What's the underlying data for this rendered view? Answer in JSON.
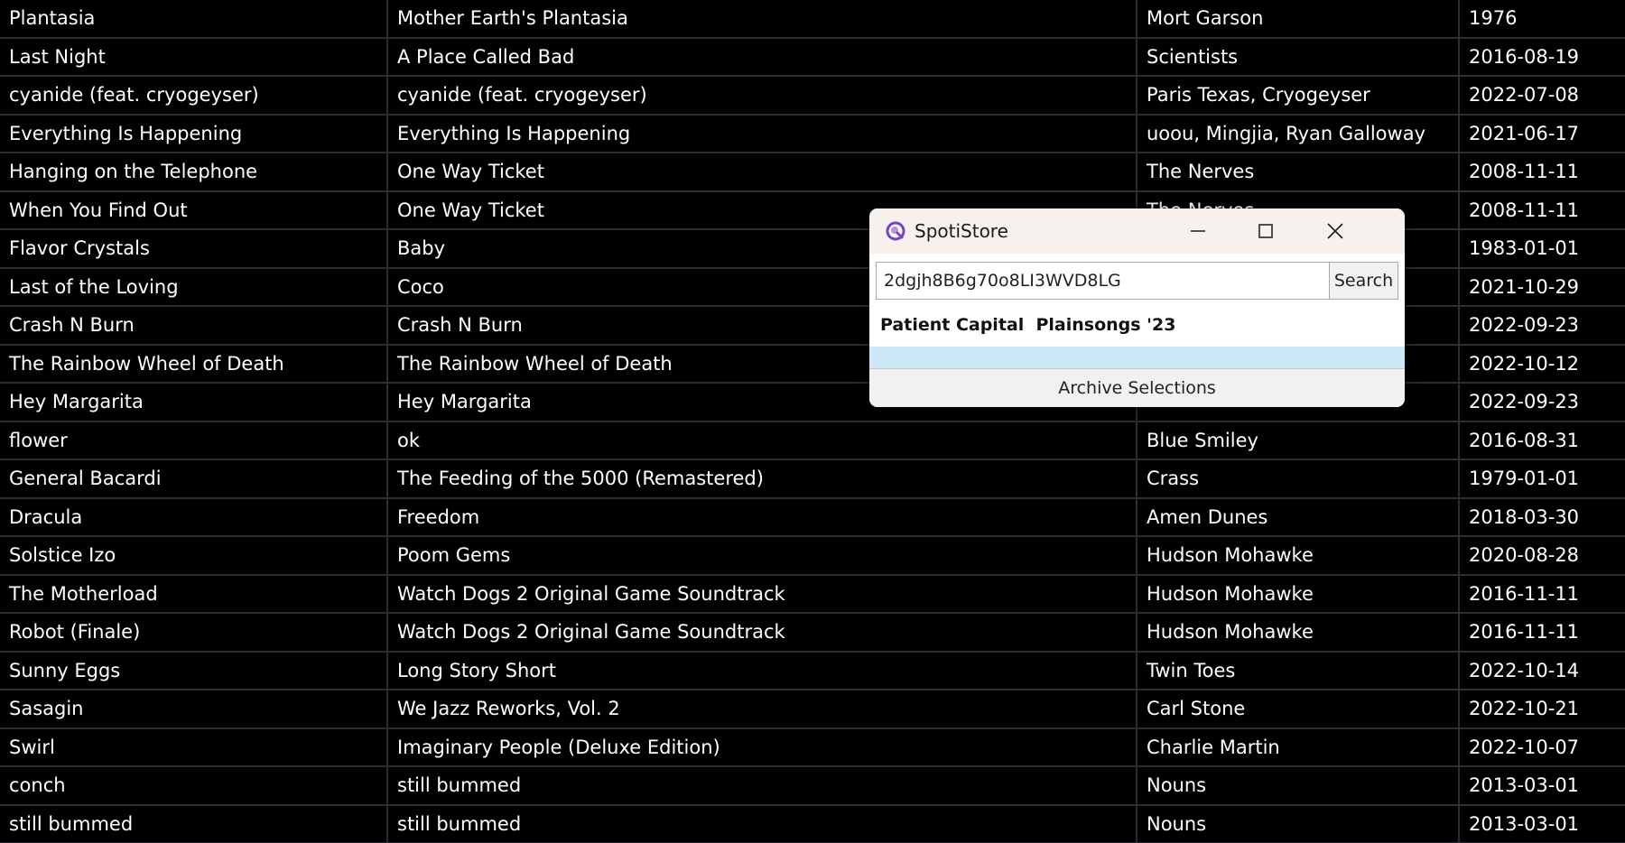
{
  "table": {
    "rows": [
      {
        "title": "Plantasia",
        "album": "Mother Earth's Plantasia",
        "artist": "Mort Garson",
        "date": "1976"
      },
      {
        "title": "Last Night",
        "album": "A Place Called Bad",
        "artist": "Scientists",
        "date": "2016-08-19"
      },
      {
        "title": "cyanide (feat. cryogeyser)",
        "album": "cyanide (feat. cryogeyser)",
        "artist": "Paris Texas, Cryogeyser",
        "date": "2022-07-08"
      },
      {
        "title": "Everything Is Happening",
        "album": "Everything Is Happening",
        "artist": "uoou, Mingjia, Ryan Galloway",
        "date": "2021-06-17"
      },
      {
        "title": "Hanging on the Telephone",
        "album": "One Way Ticket",
        "artist": "The Nerves",
        "date": "2008-11-11"
      },
      {
        "title": "When You Find Out",
        "album": "One Way Ticket",
        "artist": "The Nerves",
        "date": "2008-11-11"
      },
      {
        "title": "Flavor Crystals",
        "album": "Baby",
        "artist": "",
        "date": "1983-01-01"
      },
      {
        "title": "Last of the Loving",
        "album": "Coco",
        "artist": "",
        "date": "2021-10-29"
      },
      {
        "title": "Crash N Burn",
        "album": "Crash N Burn",
        "artist": "",
        "date": "2022-09-23"
      },
      {
        "title": "The Rainbow Wheel of Death",
        "album": "The Rainbow Wheel of Death",
        "artist": "",
        "date": "2022-10-12"
      },
      {
        "title": "Hey Margarita",
        "album": "Hey Margarita",
        "artist": "",
        "date": "2022-09-23"
      },
      {
        "title": "flower",
        "album": "ok",
        "artist": "Blue Smiley",
        "date": "2016-08-31"
      },
      {
        "title": "General Bacardi",
        "album": "The Feeding of the 5000 (Remastered)",
        "artist": "Crass",
        "date": "1979-01-01"
      },
      {
        "title": "Dracula",
        "album": "Freedom",
        "artist": "Amen Dunes",
        "date": "2018-03-30"
      },
      {
        "title": "Solstice Izo",
        "album": "Poom Gems",
        "artist": "Hudson Mohawke",
        "date": "2020-08-28"
      },
      {
        "title": "The Motherload",
        "album": "Watch Dogs 2 Original Game Soundtrack",
        "artist": "Hudson Mohawke",
        "date": "2016-11-11"
      },
      {
        "title": "Robot (Finale)",
        "album": "Watch Dogs 2 Original Game Soundtrack",
        "artist": "Hudson Mohawke",
        "date": "2016-11-11"
      },
      {
        "title": "Sunny Eggs",
        "album": "Long Story Short",
        "artist": "Twin Toes",
        "date": "2022-10-14"
      },
      {
        "title": "Sasagin",
        "album": "We Jazz Reworks, Vol. 2",
        "artist": "Carl Stone",
        "date": "2022-10-21"
      },
      {
        "title": "Swirl",
        "album": "Imaginary People (Deluxe Edition)",
        "artist": "Charlie Martin",
        "date": "2022-10-07"
      },
      {
        "title": "conch",
        "album": "still bummed",
        "artist": "Nouns",
        "date": "2013-03-01"
      },
      {
        "title": "still bummed",
        "album": "still bummed",
        "artist": "Nouns",
        "date": "2013-03-01"
      }
    ]
  },
  "dialog": {
    "title": "SpotiStore",
    "app_icon": "spotistore-app-icon",
    "search_value": "2dgjh8B6g70o8LI3WVD8LG",
    "search_button": "Search",
    "result_text": "Patient Capital  Plainsongs '23",
    "archive_button": "Archive Selections",
    "icons": {
      "minimize": "minimize-icon",
      "maximize": "maximize-icon",
      "close": "close-icon"
    }
  },
  "colors": {
    "background": "#000000",
    "grid_line": "#2a2f35",
    "text": "#ffffff",
    "dialog_titlebar": "#f6f1ec",
    "selection": "#cde8f7"
  }
}
